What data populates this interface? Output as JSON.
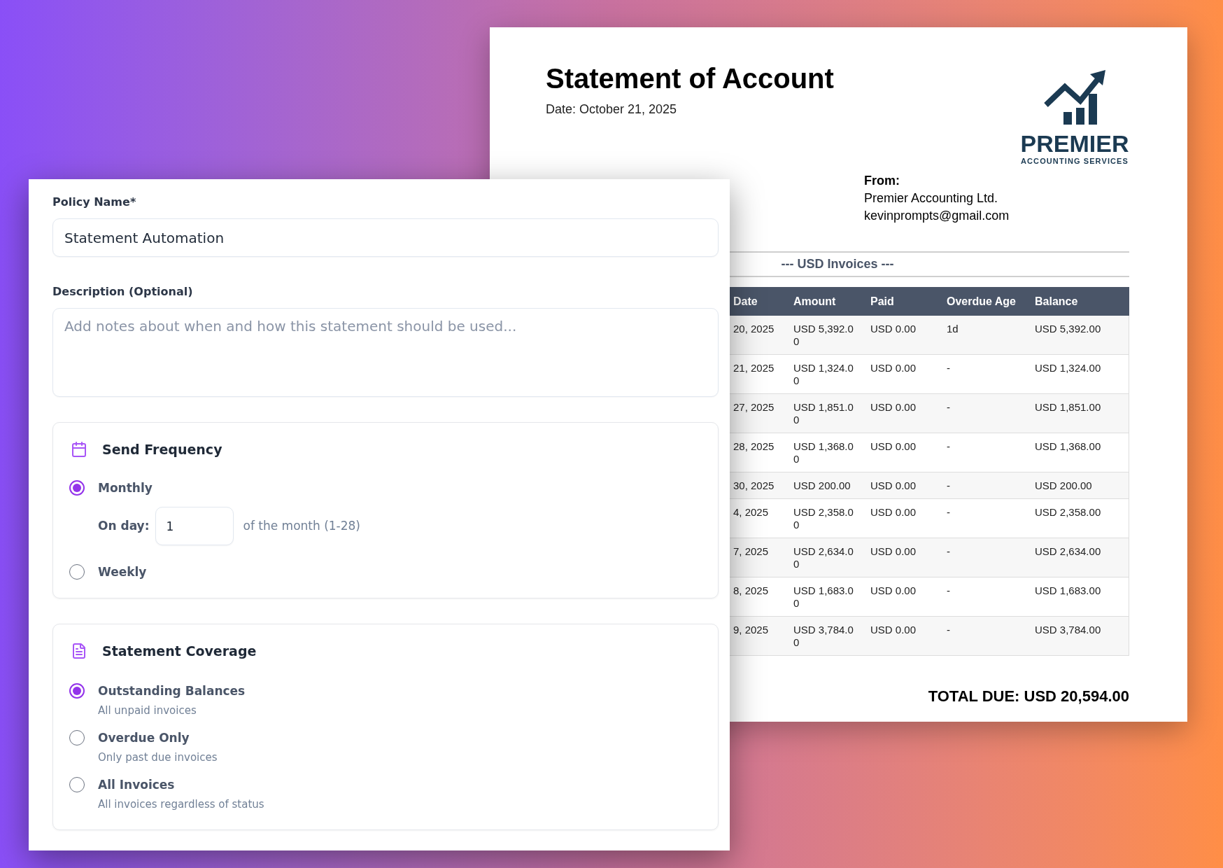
{
  "statement": {
    "title": "Statement of Account",
    "date": "Date: October 21, 2025",
    "logo": {
      "name": "PREMIER",
      "tagline": "ACCOUNTING SERVICES"
    },
    "from": {
      "label": "From:",
      "lines": [
        "Premier Accounting Ltd.",
        "kevinprompts@gmail.com"
      ]
    },
    "section_title": "--- USD Invoices ---",
    "table": {
      "columns": [
        "Date",
        "Amount",
        "Paid",
        "Overdue Age",
        "Balance"
      ],
      "rows": [
        [
          "20, 2025",
          "USD 5,392.00",
          "USD 0.00",
          "1d",
          "USD 5,392.00"
        ],
        [
          "21, 2025",
          "USD 1,324.00",
          "USD 0.00",
          "-",
          "USD 1,324.00"
        ],
        [
          "27, 2025",
          "USD 1,851.00",
          "USD 0.00",
          "-",
          "USD 1,851.00"
        ],
        [
          "28, 2025",
          "USD 1,368.00",
          "USD 0.00",
          "-",
          "USD 1,368.00"
        ],
        [
          "30, 2025",
          "USD 200.00",
          "USD 0.00",
          "-",
          "USD 200.00"
        ],
        [
          "4, 2025",
          "USD 2,358.00",
          "USD 0.00",
          "-",
          "USD 2,358.00"
        ],
        [
          "7, 2025",
          "USD 2,634.00",
          "USD 0.00",
          "-",
          "USD 2,634.00"
        ],
        [
          "8, 2025",
          "USD 1,683.00",
          "USD 0.00",
          "-",
          "USD 1,683.00"
        ],
        [
          "9, 2025",
          "USD 3,784.00",
          "USD 0.00",
          "-",
          "USD 3,784.00"
        ]
      ]
    },
    "total": "TOTAL DUE: USD 20,594.00"
  },
  "form": {
    "fields": [
      {
        "kind": "input",
        "label": "Policy Name*",
        "value": "Statement Automation"
      },
      {
        "kind": "textarea",
        "label": "Description (Optional)",
        "placeholder": "Add notes about when and how this statement should be used..."
      }
    ],
    "frequency": {
      "title": "Send Frequency",
      "options": [
        {
          "label": "Monthly",
          "selected": true,
          "day": {
            "label": "On day:",
            "value": "1",
            "hint": "of the month (1-28)"
          }
        },
        {
          "label": "Weekly",
          "selected": false
        }
      ]
    },
    "coverage": {
      "title": "Statement Coverage",
      "options": [
        {
          "label": "Outstanding Balances",
          "description": "All unpaid invoices",
          "selected": true
        },
        {
          "label": "Overdue Only",
          "description": "Only past due invoices",
          "selected": false
        },
        {
          "label": "All Invoices",
          "description": "All invoices regardless of status",
          "selected": false
        }
      ]
    }
  }
}
